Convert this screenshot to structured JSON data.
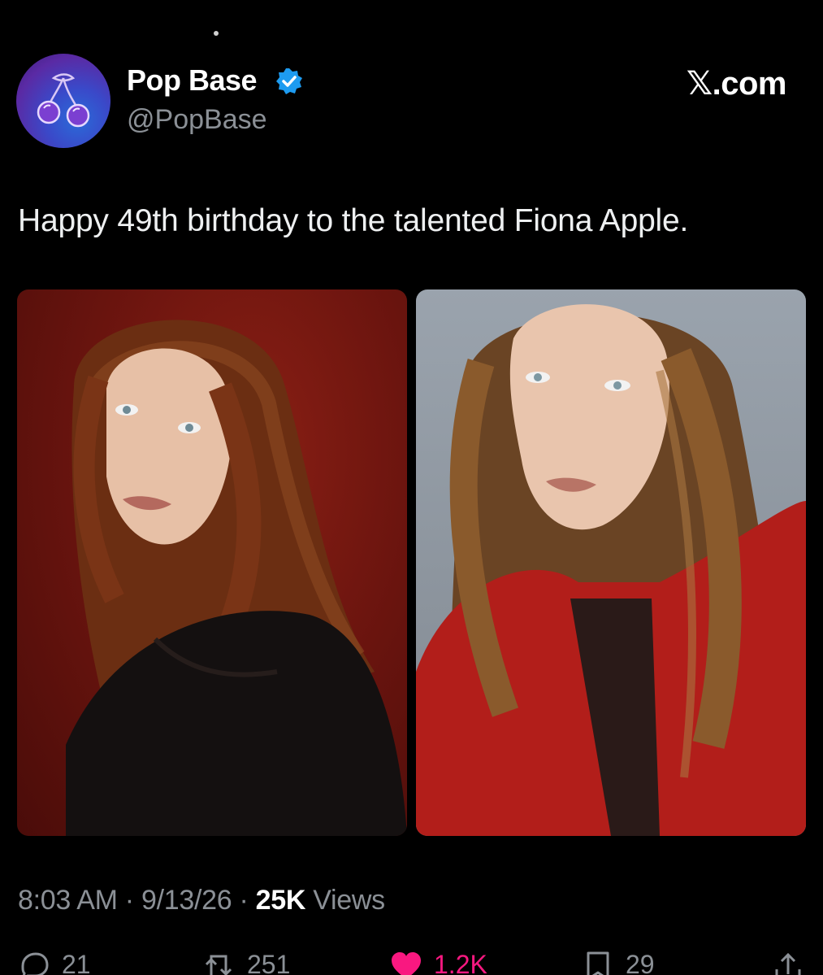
{
  "author": {
    "display_name": "Pop Base",
    "handle": "@PopBase",
    "verified_icon": "verified-badge-icon",
    "avatar_icon": "cherry-logo-icon"
  },
  "site_label": "𝕏.com",
  "tweet": {
    "text": "Happy 49th birthday to the talented Fiona Apple."
  },
  "media": [
    {
      "name": "photo-1",
      "description_icon": "portrait-photo"
    },
    {
      "name": "photo-2",
      "description_icon": "portrait-photo"
    }
  ],
  "meta": {
    "time": "8:03 AM",
    "separator1": " · ",
    "date": "9/13/26",
    "separator2": " · ",
    "views_count": "25K",
    "views_label": " Views"
  },
  "actions": {
    "reply_count": "21",
    "retweet_count": "251",
    "like_count": "1.2K",
    "bookmark_count": "29"
  },
  "colors": {
    "background": "#000000",
    "text": "#e7e9ea",
    "muted": "#8b9096",
    "verified": "#1d9bf0",
    "like": "#f91880"
  }
}
